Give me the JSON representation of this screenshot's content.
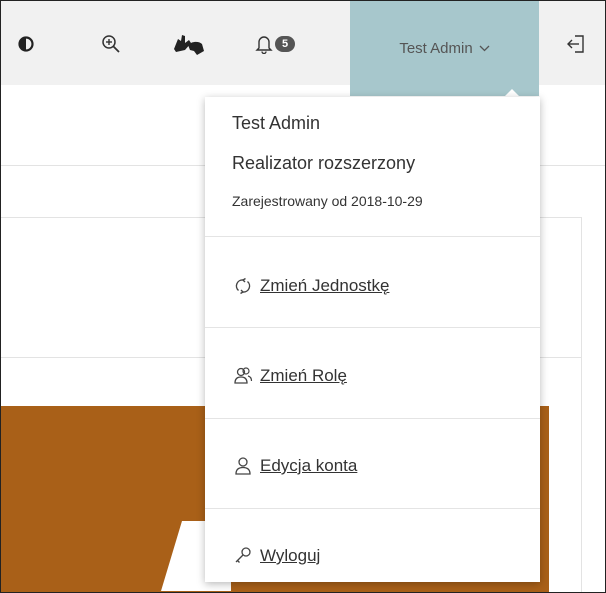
{
  "topbar": {
    "notifications_count": "5",
    "user_name": "Test Admin"
  },
  "dropdown": {
    "name": "Test Admin",
    "role": "Realizator rozszerzony",
    "registered": "Zarejestrowany od 2018-10-29",
    "items": [
      {
        "label": "Zmień Jednostkę",
        "icon": "refresh-icon"
      },
      {
        "label": "Zmień Rolę",
        "icon": "users-icon"
      },
      {
        "label": "Edycja konta",
        "icon": "user-icon"
      },
      {
        "label": "Wyloguj",
        "icon": "key-icon"
      }
    ]
  },
  "colors": {
    "topbar_bg": "#f1f1f1",
    "user_toggle_bg": "#a7c7cc",
    "banner_orange": "#a96018"
  }
}
